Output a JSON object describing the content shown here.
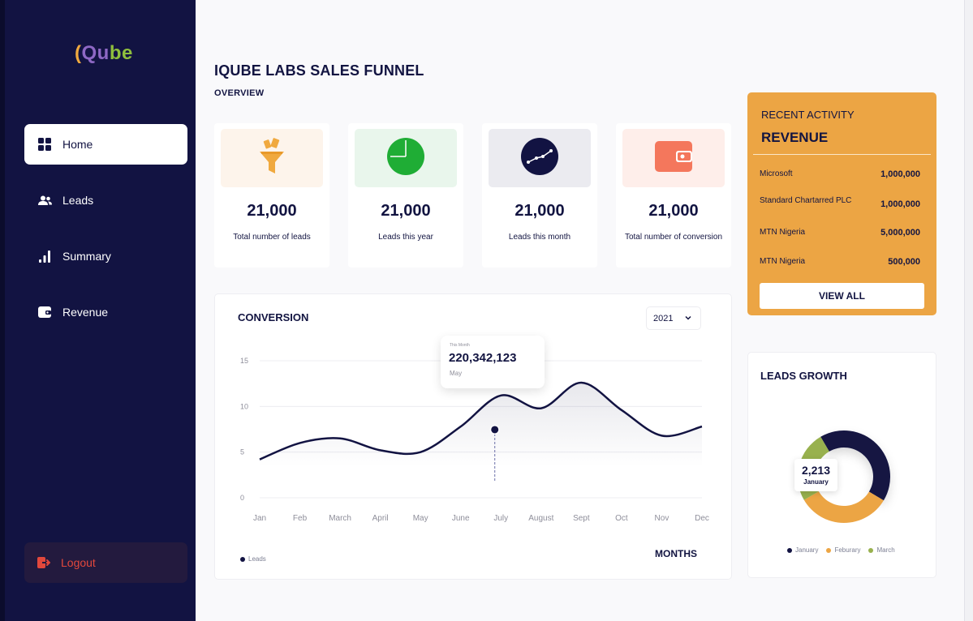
{
  "sidebar": {
    "logo": {
      "part1": "(",
      "part2": "Qu",
      "part3": "be"
    },
    "items": [
      {
        "label": "Home",
        "icon": "grid-icon"
      },
      {
        "label": "Leads",
        "icon": "users-icon"
      },
      {
        "label": "Summary",
        "icon": "bar-chart-icon"
      },
      {
        "label": "Revenue",
        "icon": "wallet-icon"
      }
    ],
    "logout": "Logout"
  },
  "header": {
    "title": "IQUBE LABS SALES FUNNEL",
    "subtitle": "OVERVIEW"
  },
  "stats": [
    {
      "value": "21,000",
      "label": "Total number of leads",
      "icon": "funnel-icon",
      "color": "#fdf4eb"
    },
    {
      "value": "21,000",
      "label": "Leads this year",
      "icon": "pie-icon",
      "color": "#e9f6ec"
    },
    {
      "value": "21,000",
      "label": "Leads this month",
      "icon": "trend-icon",
      "color": "#ebebf0"
    },
    {
      "value": "21,000",
      "label": "Total number of conversion",
      "icon": "wallet-icon",
      "color": "#feeeea"
    }
  ],
  "conversion": {
    "title": "CONVERSION",
    "year": "2021",
    "tooltip": {
      "small": "This Month",
      "value": "220,342,123",
      "month": "May"
    },
    "legend": "Leads",
    "x_title": "MONTHS"
  },
  "chart_data": {
    "type": "area",
    "categories": [
      "Jan",
      "Feb",
      "March",
      "April",
      "May",
      "June",
      "July",
      "August",
      "Sept",
      "Oct",
      "Nov",
      "Dec"
    ],
    "series": [
      {
        "name": "Leads",
        "values": [
          4.2,
          6.0,
          6.5,
          5.2,
          5.0,
          7.8,
          11.2,
          9.8,
          12.6,
          9.6,
          6.8,
          7.8
        ]
      }
    ],
    "yticks": [
      0,
      5,
      10,
      15
    ],
    "ylim": [
      0,
      15
    ],
    "highlight": {
      "x": "June",
      "y": 10.3
    },
    "grid": true,
    "color": "#121342"
  },
  "activity": {
    "heading": "RECENT ACTIVITY",
    "title": "REVENUE",
    "rows": [
      {
        "name": "Microsoft",
        "amount": "1,000,000"
      },
      {
        "name": "Standard Chartarred PLC",
        "amount": "1,000,000"
      },
      {
        "name": "MTN Nigeria",
        "amount": "5,000,000"
      },
      {
        "name": "MTN Nigeria",
        "amount": "500,000"
      }
    ],
    "button": "VIEW ALL"
  },
  "growth": {
    "title": "LEADS GROWTH",
    "tooltip": {
      "value": "2,213",
      "month": "January"
    },
    "legend": [
      {
        "label": "January",
        "color": "#121342"
      },
      {
        "label": "Feburary",
        "color": "#eca544"
      },
      {
        "label": "March",
        "color": "#98b14e"
      }
    ],
    "donut_values": [
      0.42,
      0.33,
      0.25
    ]
  }
}
